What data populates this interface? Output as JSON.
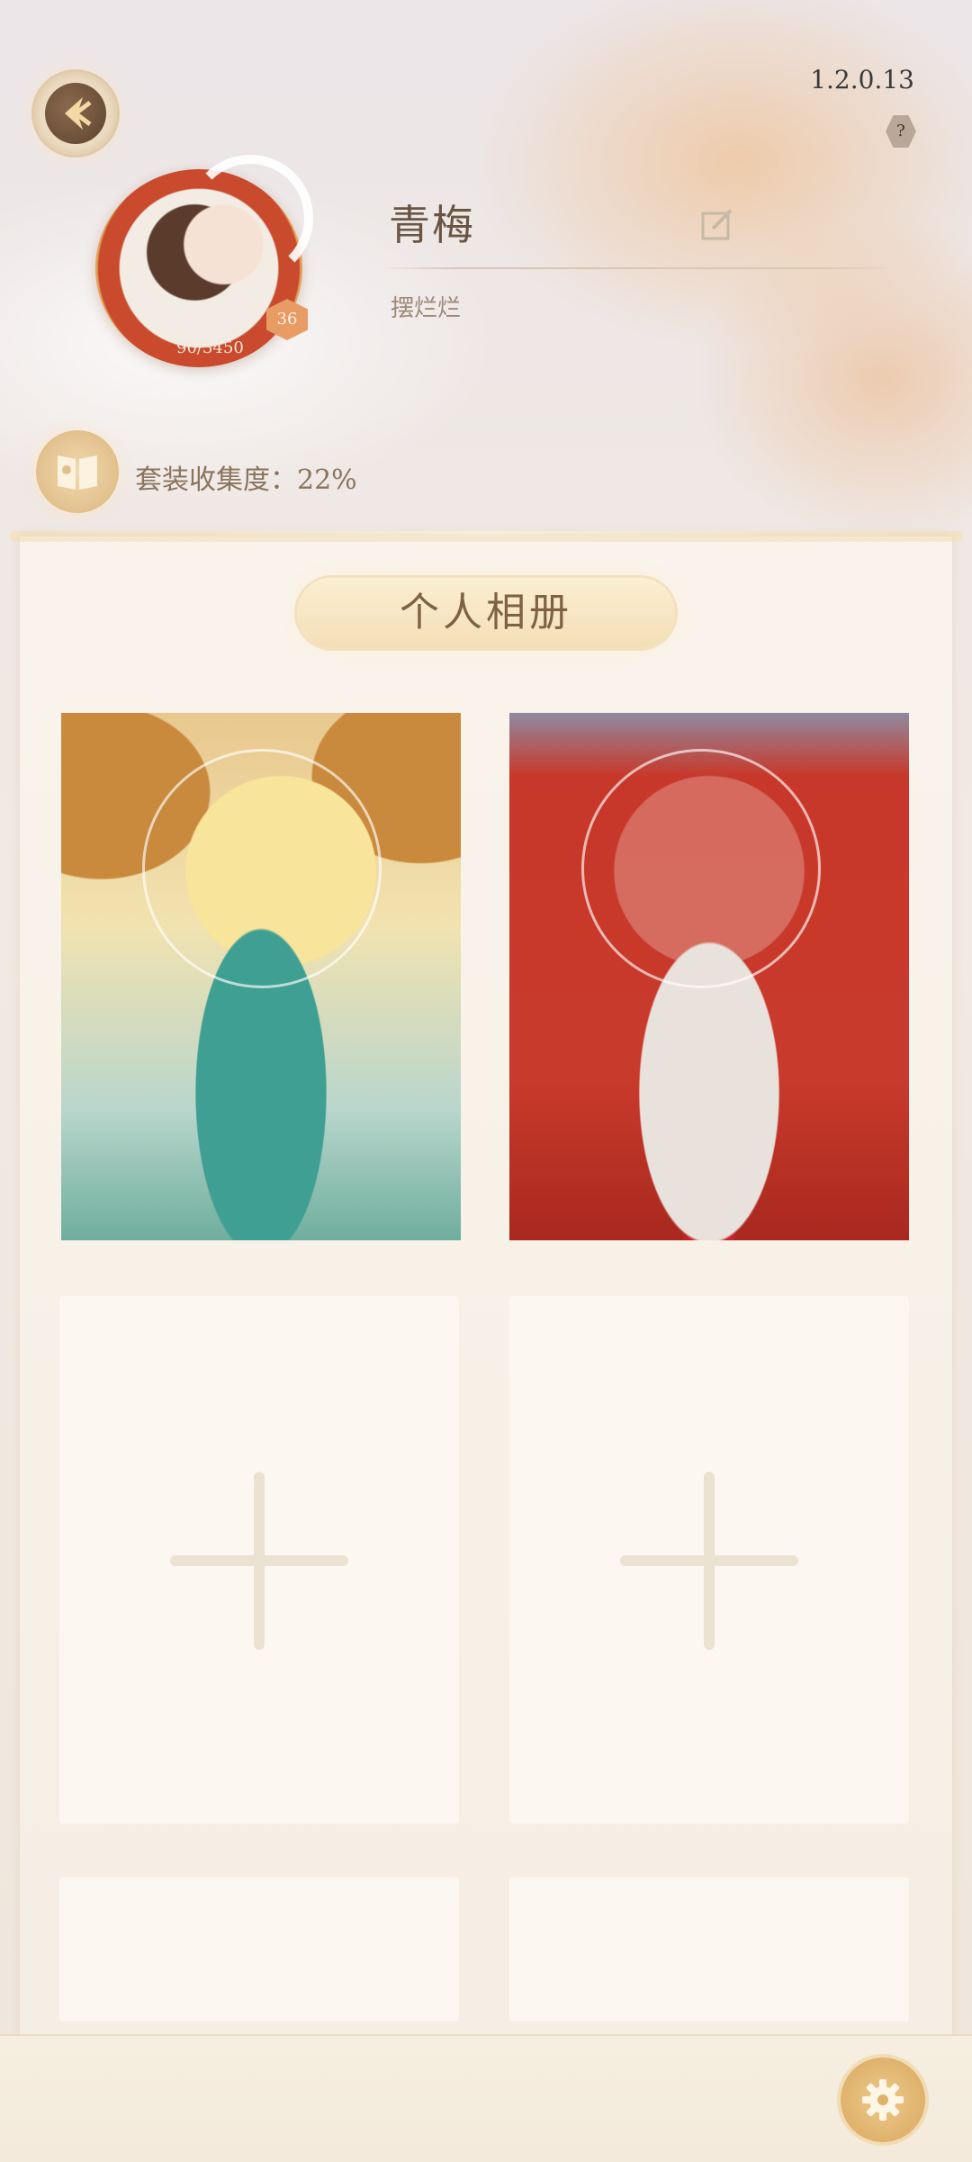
{
  "header": {
    "version": "1.2.0.13",
    "help_label": "?"
  },
  "profile": {
    "name": "青梅",
    "signature": "摆烂烂",
    "level": "36",
    "exp": "90/3450"
  },
  "collection": {
    "text": "套装收集度：22%"
  },
  "album": {
    "title": "个人相册"
  },
  "icons": {
    "back": "back-arrow-icon",
    "edit": "edit-icon",
    "collection": "book-icon",
    "add": "plus-icon",
    "settings": "gear-icon"
  }
}
